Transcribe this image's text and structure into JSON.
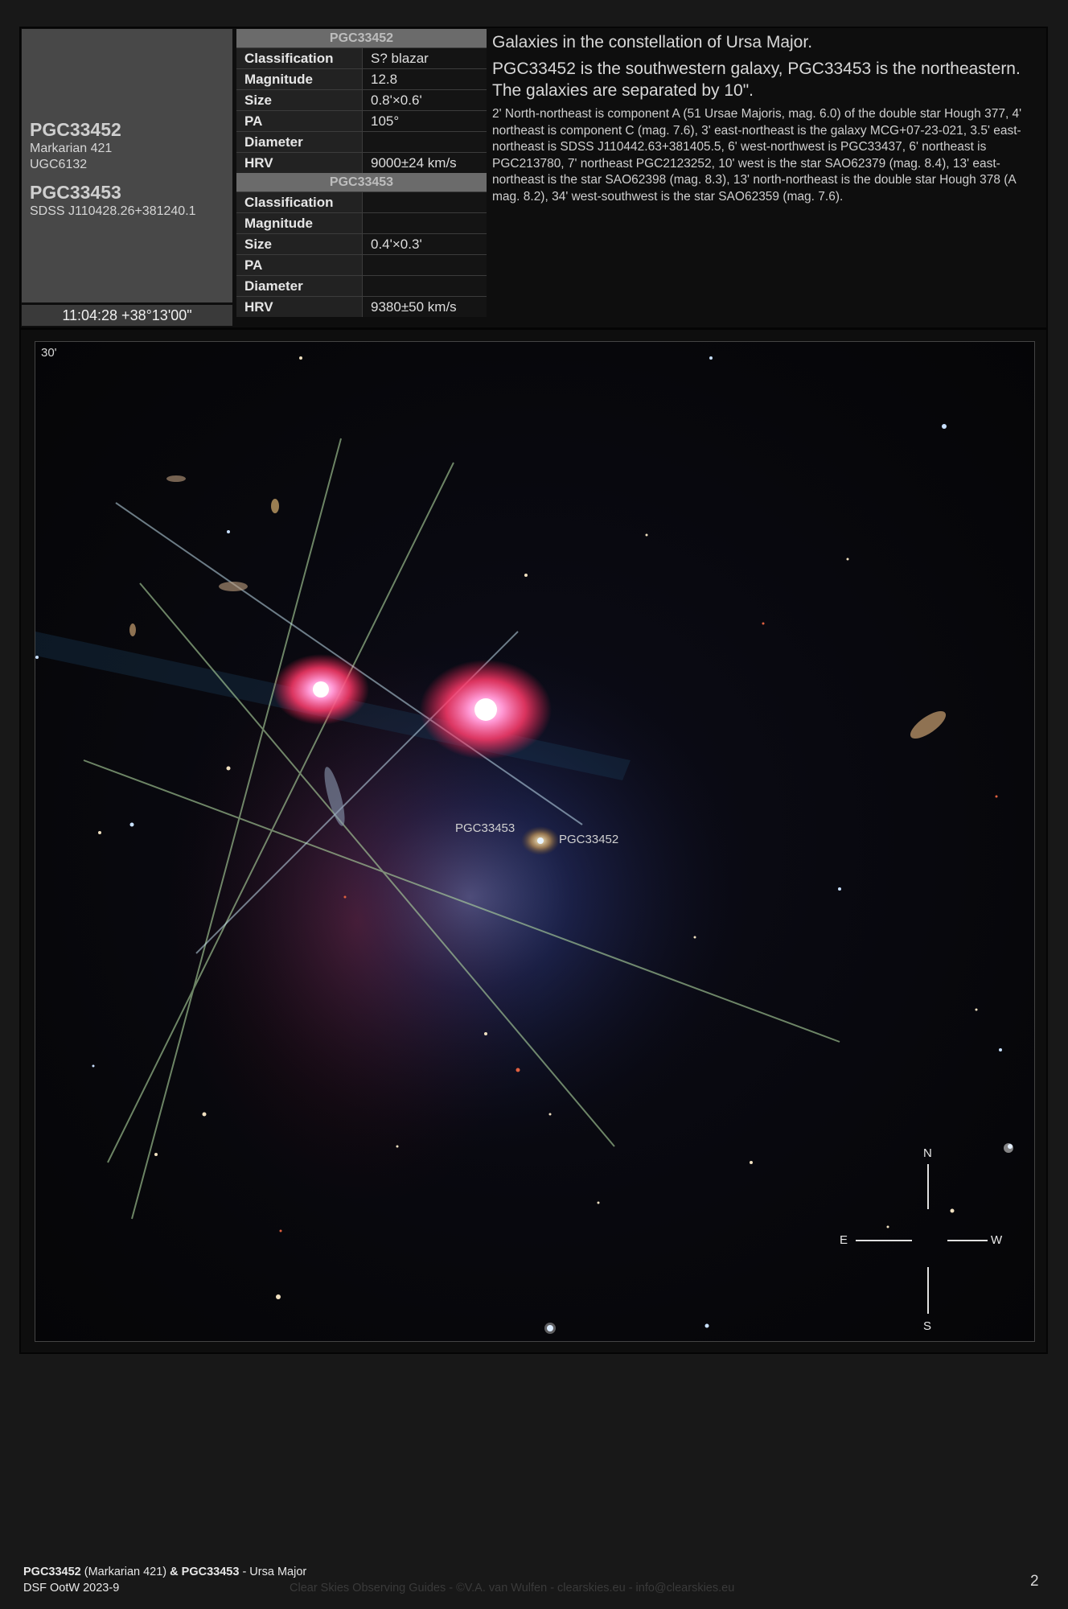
{
  "object1": {
    "name": "PGC33452",
    "alt1": "Markarian 421",
    "alt2": "UGC6132"
  },
  "object2": {
    "name": "PGC33453",
    "alt1": "SDSS J110428.26+381240.1"
  },
  "coordinates": "11:04:28 +38°13'00\"",
  "table1": {
    "header": "PGC33452",
    "rows": [
      {
        "label": "Classification",
        "value": "S? blazar"
      },
      {
        "label": "Magnitude",
        "value": "12.8"
      },
      {
        "label": "Size",
        "value": "0.8'×0.6'"
      },
      {
        "label": "PA",
        "value": "105°"
      },
      {
        "label": "Diameter",
        "value": ""
      },
      {
        "label": "HRV",
        "value": "9000±24 km/s"
      }
    ]
  },
  "table2": {
    "header": "PGC33453",
    "rows": [
      {
        "label": "Classification",
        "value": ""
      },
      {
        "label": "Magnitude",
        "value": ""
      },
      {
        "label": "Size",
        "value": "0.4'×0.3'"
      },
      {
        "label": "PA",
        "value": ""
      },
      {
        "label": "Diameter",
        "value": ""
      },
      {
        "label": "HRV",
        "value": "9380±50 km/s"
      }
    ]
  },
  "description": {
    "line1": "Galaxies in the constellation of Ursa Major.",
    "line2": "PGC33452 is the southwestern galaxy, PGC33453 is the northeastern.",
    "line3": "The galaxies are separated by 10\".",
    "details": "2' North-northeast is component A (51 Ursae Majoris, mag. 6.0) of the double star Hough 377, 4' northeast is component C (mag. 7.6), 3' east-northeast is the galaxy MCG+07-23-021, 3.5' east-northeast is SDSS J110442.63+381405.5, 6' west-northwest is PGC33437, 6' northeast is PGC213780, 7' northeast PGC2123252, 10' west is the star SAO62379 (mag. 8.4), 13' east-northeast is the star SAO62398 (mag. 8.3), 13' north-northeast is the double star Hough 378 (A mag. 8.2), 34' west-southwest is the star SAO62359 (mag. 7.6)."
  },
  "image": {
    "scale": "30'",
    "label_a": "PGC33453",
    "label_b": "PGC33452",
    "compass": {
      "n": "N",
      "s": "S",
      "e": "E",
      "w": "W"
    }
  },
  "footer": {
    "title_bold1": "PGC33452",
    "title_mid": " (Markarian 421) ",
    "title_amp": "&",
    "title_bold2": " PGC33453",
    "title_tail": " - Ursa Major",
    "series": "DSF OotW 2023-9",
    "credit": "Clear Skies Observing Guides - ©V.A. van Wulfen - clearskies.eu - info@clearskies.eu",
    "page": "2"
  }
}
